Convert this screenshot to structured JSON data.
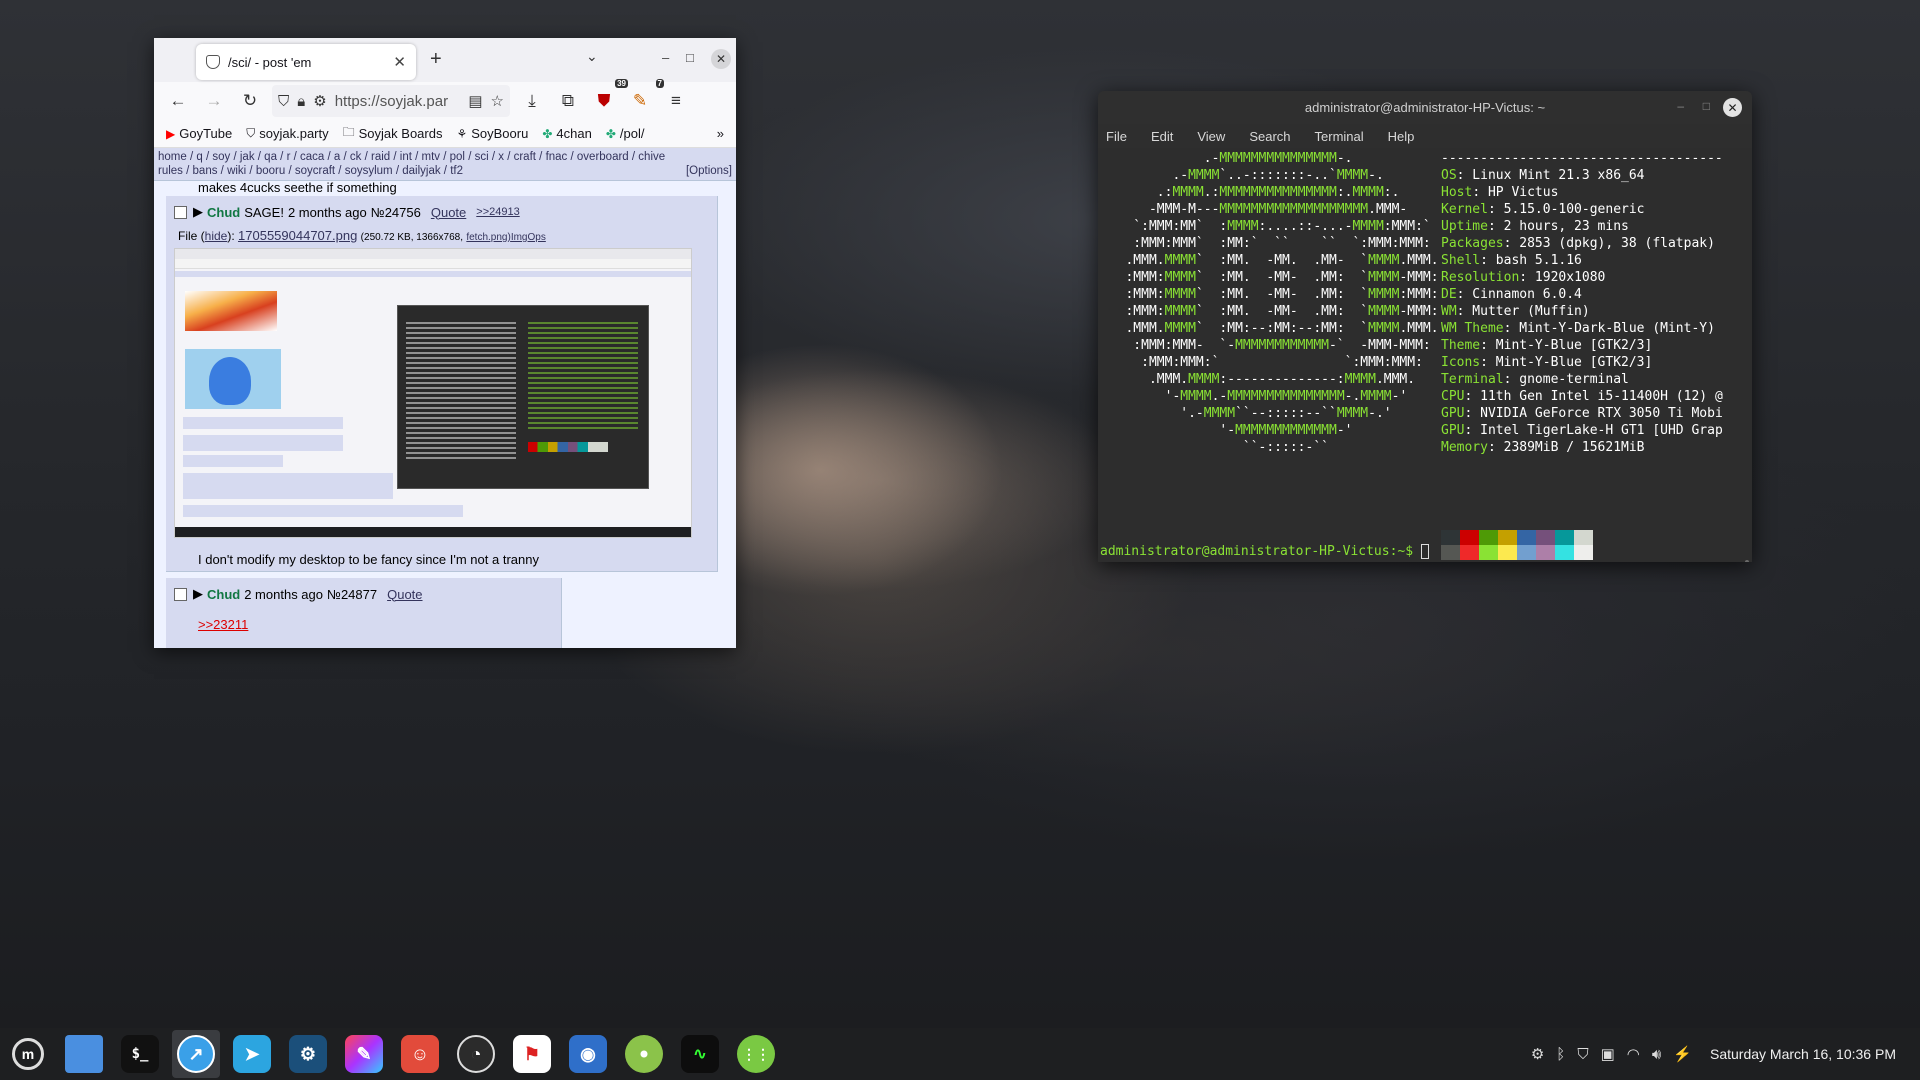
{
  "firefox": {
    "tab_title": "/sci/ - post 'em",
    "url": "https://soyjak.par",
    "bookmarks": [
      {
        "label": "GoyTube",
        "icon": "youtube-icon"
      },
      {
        "label": "soyjak.party",
        "icon": "shield-icon"
      },
      {
        "label": "Soyjak Boards",
        "icon": "folder-icon"
      },
      {
        "label": "SoyBooru",
        "icon": "booru-icon"
      },
      {
        "label": "4chan",
        "icon": "clover-icon"
      },
      {
        "label": "/pol/",
        "icon": "clover-icon"
      }
    ],
    "ext_badge_1": "39",
    "ext_badge_2": "7",
    "board_nav_line1": [
      "home",
      "q",
      "soy",
      "jak",
      "qa",
      "r",
      "caca",
      "a",
      "ck",
      "raid",
      "int",
      "mtv",
      "pol",
      "sci",
      "x",
      "craft",
      "fnac",
      "overboard",
      "chive"
    ],
    "board_nav_line2": [
      "rules",
      "bans",
      "wiki",
      "booru",
      "soycraft",
      "soysylum",
      "dailyjak",
      "tf2"
    ],
    "options_label": "[Options]",
    "prev_post_tail": "makes 4cucks seethe if something",
    "post1": {
      "name": "Chud",
      "sage": "SAGE!",
      "time": "2 months ago",
      "no": "№24756",
      "quote": "Quote",
      "backlink": ">>24913",
      "file_prefix": "File (",
      "hide": "hide",
      "file_mid": "): ",
      "filename": "1705559044707.png",
      "file_meta": "(250.72 KB, 1366x768,",
      "file_fetch": "fetch.png)",
      "imgops": "ImgOps",
      "body": "I don't modify my desktop to be fancy since I'm not a tranny"
    },
    "post2": {
      "name": "Chud",
      "time": "2 months ago",
      "no": "№24877",
      "quote": "Quote",
      "reply_link": ">>23211"
    }
  },
  "terminal": {
    "title": "administrator@administrator-HP-Victus: ~",
    "menu": [
      "File",
      "Edit",
      "View",
      "Search",
      "Terminal",
      "Help"
    ],
    "separator": "------------------------------------",
    "info": [
      {
        "k": "OS",
        "v": "Linux Mint 21.3 x86_64"
      },
      {
        "k": "Host",
        "v": "HP Victus"
      },
      {
        "k": "Kernel",
        "v": "5.15.0-100-generic"
      },
      {
        "k": "Uptime",
        "v": "2 hours, 23 mins"
      },
      {
        "k": "Packages",
        "v": "2853 (dpkg), 38 (flatpak)"
      },
      {
        "k": "Shell",
        "v": "bash 5.1.16"
      },
      {
        "k": "Resolution",
        "v": "1920x1080"
      },
      {
        "k": "DE",
        "v": "Cinnamon 6.0.4"
      },
      {
        "k": "WM",
        "v": "Mutter (Muffin)"
      },
      {
        "k": "WM Theme",
        "v": "Mint-Y-Dark-Blue (Mint-Y)"
      },
      {
        "k": "Theme",
        "v": "Mint-Y-Blue [GTK2/3]"
      },
      {
        "k": "Icons",
        "v": "Mint-Y-Blue [GTK2/3]"
      },
      {
        "k": "Terminal",
        "v": "gnome-terminal"
      },
      {
        "k": "CPU",
        "v": "11th Gen Intel i5-11400H (12) @"
      },
      {
        "k": "GPU",
        "v": "NVIDIA GeForce RTX 3050 Ti Mobi"
      },
      {
        "k": "GPU",
        "v": "Intel TigerLake-H GT1 [UHD Grap"
      },
      {
        "k": "Memory",
        "v": "2389MiB / 15621MiB"
      }
    ],
    "ascii_lines": [
      "             .-MMMMMMMMMMMMMMM-.",
      "         .-MMMM`..-:::::::-..`MMMM-.",
      "       .:MMMM.:MMMMMMMMMMMMMMM:.MMMM:.",
      "      -MMM-M---MMMMMMMMMMMMMMMMMMM.MMM-",
      "    `:MMM:MM`  :MMMM:....::-...-MMMM:MMM:`",
      "    :MMM:MMM`  :MM:`  ``    ``  `:MMM:MMM:",
      "   .MMM.MMMM`  :MM.  -MM.  .MM-  `MMMM.MMM.",
      "   :MMM:MMMM`  :MM.  -MM-  .MM:  `MMMM-MMM:",
      "   :MMM:MMMM`  :MM.  -MM-  .MM:  `MMMM:MMM:",
      "   :MMM:MMMM`  :MM.  -MM-  .MM:  `MMMM-MMM:",
      "   .MMM.MMMM`  :MM:--:MM:--:MM:  `MMMM.MMM.",
      "    :MMM:MMM-  `-MMMMMMMMMMMM-`  -MMM-MMM:",
      "     :MMM:MMM:`                `:MMM:MMM:",
      "      .MMM.MMMM:--------------:MMMM.MMM.",
      "        '-MMMM.-MMMMMMMMMMMMMMM-.MMMM-'",
      "          '.-MMMM``--:::::--``MMMM-.'",
      "               '-MMMMMMMMMMMMM-'",
      "                  ``-:::::-``"
    ],
    "swatch_colors": [
      "#2e3436",
      "#cc0000",
      "#4e9a06",
      "#c4a000",
      "#3465a4",
      "#75507b",
      "#06989a",
      "#d3d7cf",
      "#555753",
      "#ef2929",
      "#8ae234",
      "#fce94f",
      "#729fcf",
      "#ad7fa8",
      "#34e2e2",
      "#eeeeec"
    ],
    "prompt": "administrator@administrator-HP-Victus:~$ "
  },
  "taskbar": {
    "apps": [
      {
        "name": "menu",
        "icon": "mint-menu-icon"
      },
      {
        "name": "files",
        "icon": "folder-icon"
      },
      {
        "name": "terminal",
        "icon": "terminal-icon"
      },
      {
        "name": "browser",
        "icon": "browser-icon"
      },
      {
        "name": "telegram",
        "icon": "telegram-icon"
      },
      {
        "name": "steam",
        "icon": "steam-icon"
      },
      {
        "name": "krita",
        "icon": "brush-icon"
      },
      {
        "name": "gimp",
        "icon": "gimp-icon"
      },
      {
        "name": "obs",
        "icon": "obs-icon"
      },
      {
        "name": "flameshot",
        "icon": "flag-icon"
      },
      {
        "name": "screenshot",
        "icon": "camera-icon"
      },
      {
        "name": "disk",
        "icon": "disc-icon"
      },
      {
        "name": "monitor",
        "icon": "pulse-icon"
      },
      {
        "name": "apps",
        "icon": "grid-icon"
      }
    ],
    "clock": "Saturday March 16, 10:36 PM"
  }
}
